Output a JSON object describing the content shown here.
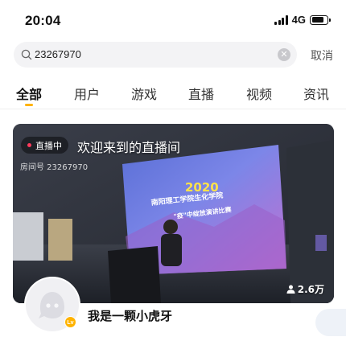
{
  "status_bar": {
    "time": "20:04",
    "network": "4G",
    "battery_level": 0.78
  },
  "search": {
    "query": "23267970",
    "cancel_label": "取消"
  },
  "tabs": [
    {
      "label": "全部",
      "active": true
    },
    {
      "label": "用户",
      "active": false
    },
    {
      "label": "游戏",
      "active": false
    },
    {
      "label": "直播",
      "active": false
    },
    {
      "label": "视频",
      "active": false
    },
    {
      "label": "资讯",
      "active": false
    }
  ],
  "live_card": {
    "live_badge": "直播中",
    "room_title": "欢迎来到的直播间",
    "room_id_text": "房间号 23267970",
    "viewer_count": "2.6万",
    "screen_text_year": "2020",
    "screen_text_line1": "南阳理工学院生化学院",
    "screen_text_line2": "\"疫\"中绽放演讲比赛",
    "streamer_name": "我是一颗小虎牙",
    "level_badge": "Lv"
  },
  "colors": {
    "accent": "#ffb300",
    "live_dot": "#ff3b5c",
    "search_bg": "#f3f3f5"
  },
  "icons": [
    "signal-icon",
    "battery-icon",
    "search-icon",
    "clear-icon",
    "person-icon",
    "avatar-placeholder-icon"
  ]
}
